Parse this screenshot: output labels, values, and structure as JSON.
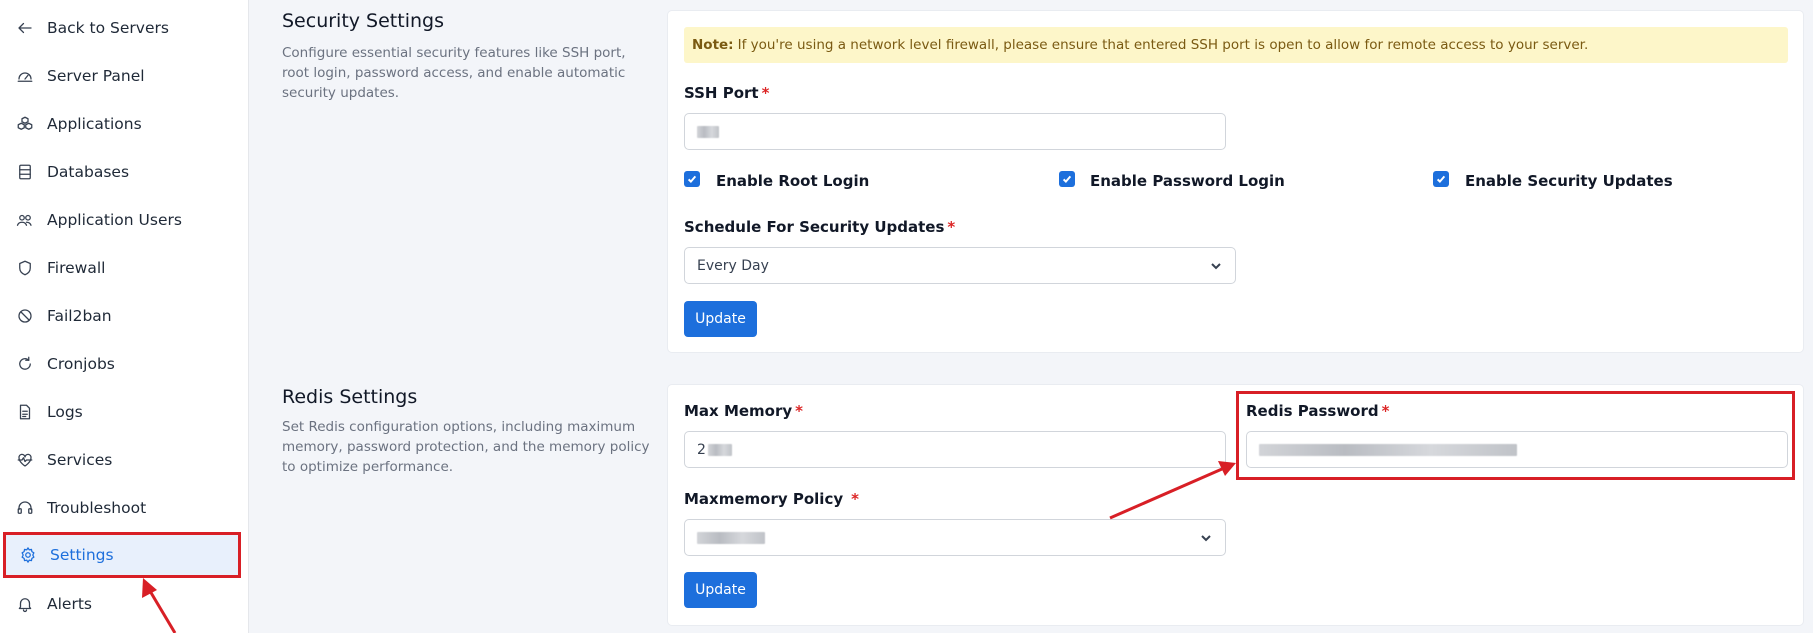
{
  "sidebar": {
    "items": [
      {
        "label": "Back to Servers",
        "icon": "arrow-left-icon"
      },
      {
        "label": "Server Panel",
        "icon": "gauge-icon"
      },
      {
        "label": "Applications",
        "icon": "cubes-icon"
      },
      {
        "label": "Databases",
        "icon": "database-icon"
      },
      {
        "label": "Application Users",
        "icon": "users-icon"
      },
      {
        "label": "Firewall",
        "icon": "shield-icon"
      },
      {
        "label": "Fail2ban",
        "icon": "ban-icon"
      },
      {
        "label": "Cronjobs",
        "icon": "refresh-icon"
      },
      {
        "label": "Logs",
        "icon": "file-text-icon"
      },
      {
        "label": "Services",
        "icon": "heart-pulse-icon"
      },
      {
        "label": "Troubleshoot",
        "icon": "headset-icon"
      },
      {
        "label": "Settings",
        "icon": "gear-icon",
        "active": true
      },
      {
        "label": "Alerts",
        "icon": "bell-icon"
      }
    ]
  },
  "security": {
    "title": "Security Settings",
    "description": "Configure essential security features like SSH port, root login, password access, and enable automatic security updates.",
    "note_prefix": "Note:",
    "note_text": "If you're using a network level firewall, please ensure that entered SSH port is open to allow for remote access to your server.",
    "ssh_port_label": "SSH Port",
    "required_mark": "*",
    "checkboxes": [
      {
        "label": "Enable Root Login",
        "checked": true
      },
      {
        "label": "Enable Password Login",
        "checked": true
      },
      {
        "label": "Enable Security Updates",
        "checked": true
      }
    ],
    "schedule_label": "Schedule For Security Updates",
    "schedule_value": "Every Day",
    "update_label": "Update"
  },
  "redis": {
    "title": "Redis Settings",
    "description": "Set Redis configuration options, including maximum memory, password protection, and the memory policy to optimize performance.",
    "max_memory_label": "Max Memory",
    "max_memory_value_visible": "2",
    "password_label": "Redis Password",
    "policy_label": "Maxmemory Policy",
    "update_label": "Update"
  },
  "colors": {
    "accent": "#1d6fdc",
    "annotation": "#d81f26",
    "note_bg": "#fdf6c9"
  }
}
